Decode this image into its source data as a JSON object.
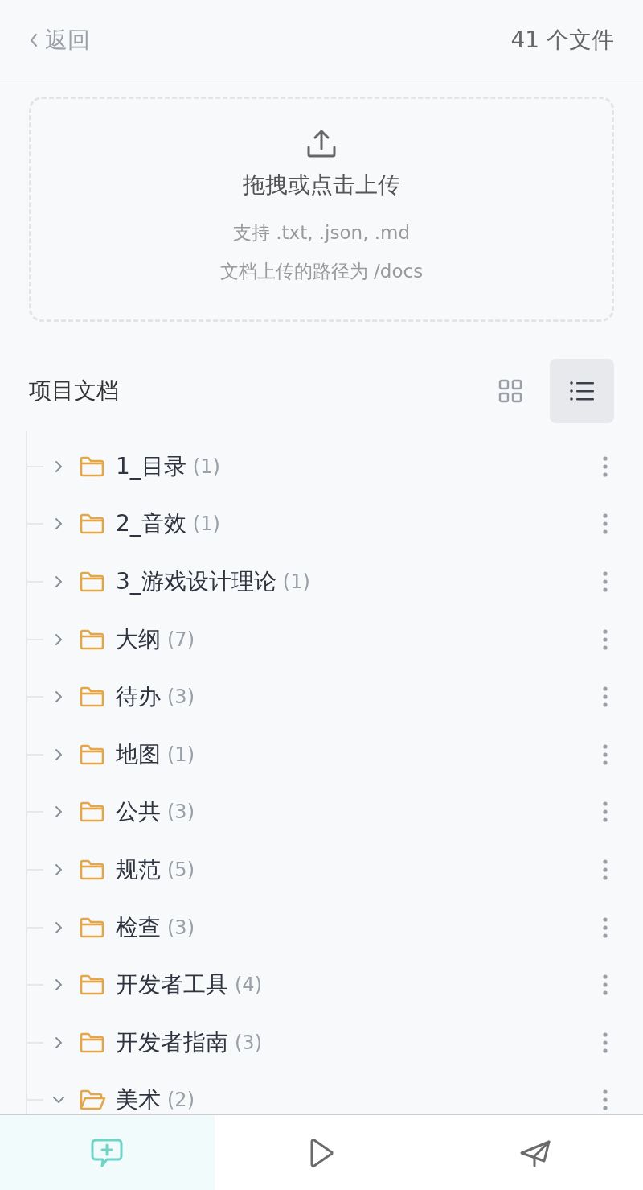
{
  "header": {
    "back_label": "返回",
    "file_count": "41 个文件"
  },
  "upload": {
    "title": "拖拽或点击上传",
    "formats": "支持 .txt, .json, .md",
    "path": "文档上传的路径为 /docs"
  },
  "section": {
    "title": "项目文档",
    "view_modes": [
      {
        "kind": "grid",
        "selected": false
      },
      {
        "kind": "list",
        "selected": true
      }
    ]
  },
  "folders": [
    {
      "name": "1_目录",
      "count": "(1)",
      "expanded": false
    },
    {
      "name": "2_音效",
      "count": "(1)",
      "expanded": false
    },
    {
      "name": "3_游戏设计理论",
      "count": "(1)",
      "expanded": false
    },
    {
      "name": "大纲",
      "count": "(7)",
      "expanded": false
    },
    {
      "name": "待办",
      "count": "(3)",
      "expanded": false
    },
    {
      "name": "地图",
      "count": "(1)",
      "expanded": false
    },
    {
      "name": "公共",
      "count": "(3)",
      "expanded": false
    },
    {
      "name": "规范",
      "count": "(5)",
      "expanded": false
    },
    {
      "name": "检查",
      "count": "(3)",
      "expanded": false
    },
    {
      "name": "开发者工具",
      "count": "(4)",
      "expanded": false
    },
    {
      "name": "开发者指南",
      "count": "(3)",
      "expanded": false
    },
    {
      "name": "美术",
      "count": "(2)",
      "expanded": true
    }
  ],
  "bottom_nav": [
    {
      "kind": "new-chat",
      "selected": true
    },
    {
      "kind": "play",
      "selected": false
    },
    {
      "kind": "send",
      "selected": false
    }
  ]
}
